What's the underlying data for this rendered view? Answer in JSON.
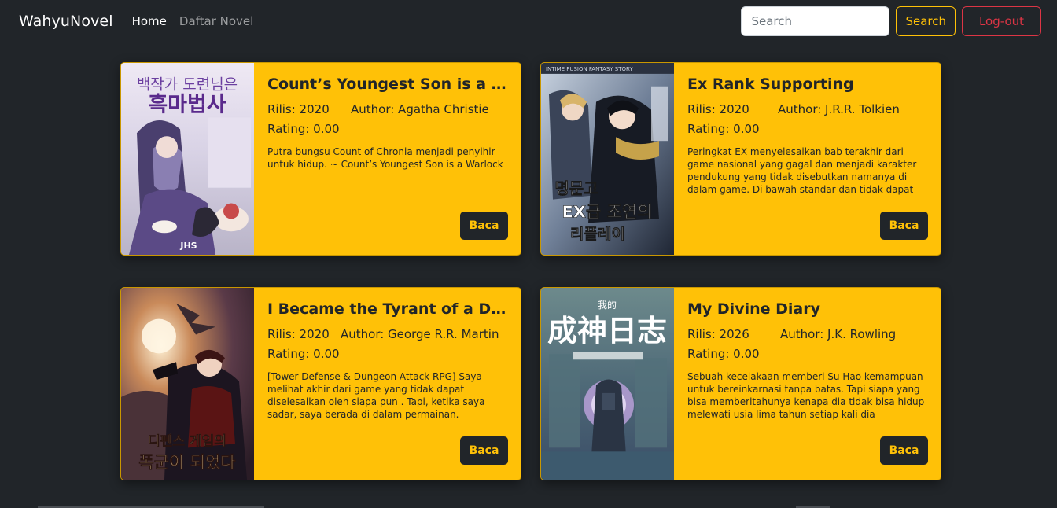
{
  "navbar": {
    "brand": "WahyuNovel",
    "links": [
      {
        "label": "Home",
        "active": true
      },
      {
        "label": "Daftar Novel",
        "active": false
      }
    ],
    "search": {
      "placeholder": "Search",
      "value": ""
    },
    "search_button": "Search",
    "logout_button": "Log-out"
  },
  "novels": [
    {
      "title": "Count’s Youngest Son is a Warlock",
      "release": "Rilis: 2020",
      "author": "Author: Agatha Christie",
      "rating": "Rating: 0.00",
      "description": "Putra bungsu Count of Chronia menjadi penyihir untuk hidup. ~ Count’s Youngest Son is a Warlock",
      "button": "Baca",
      "cover_text": [
        "백작가 도련님은",
        "흑마법사",
        "JHS"
      ]
    },
    {
      "title": "Ex Rank Supporting",
      "release": "Rilis: 2020",
      "author": "Author: J.R.R. Tolkien",
      "rating": "Rating: 0.00",
      "description": "Peringkat EX menyelesaikan bab terakhir dari game nasional yang gagal dan menjadi karakter pendukung yang tidak disebutkan namanya di dalam game. Di bawah standar dan tidak dapat",
      "button": "Baca",
      "cover_text": [
        "INTIME FUSION FANTASY STORY",
        "명문고",
        "EX급 조연의",
        "리플레이"
      ]
    },
    {
      "title": "I Became the Tyrant of a Defense Game",
      "release": "Rilis: 2020",
      "author": "Author: George R.R. Martin",
      "rating": "Rating: 0.00",
      "description": "[Tower Defense & Dungeon Attack RPG] Saya melihat akhir dari game yang tidak dapat diselesaikan oleh siapa pun . Tapi, ketika saya sadar, saya berada di dalam permainan.",
      "button": "Baca",
      "cover_text": [
        "디펜스 게임의",
        "폭군이 되었다"
      ]
    },
    {
      "title": "My Divine Diary",
      "release": "Rilis: 2026",
      "author": "Author: J.K. Rowling",
      "rating": "Rating: 0.00",
      "description": "Sebuah kecelakaan memberi Su Hao kemampuan untuk bereinkarnasi tanpa batas. Tapi siapa yang bisa memberitahunya kenapa dia tidak bisa hidup melewati usia lima tahun setiap kali dia",
      "button": "Baca",
      "cover_text": [
        "我的",
        "成神日志"
      ]
    }
  ],
  "colors": {
    "background": "#212529",
    "card": "#ffc107",
    "danger": "#dc3545"
  }
}
